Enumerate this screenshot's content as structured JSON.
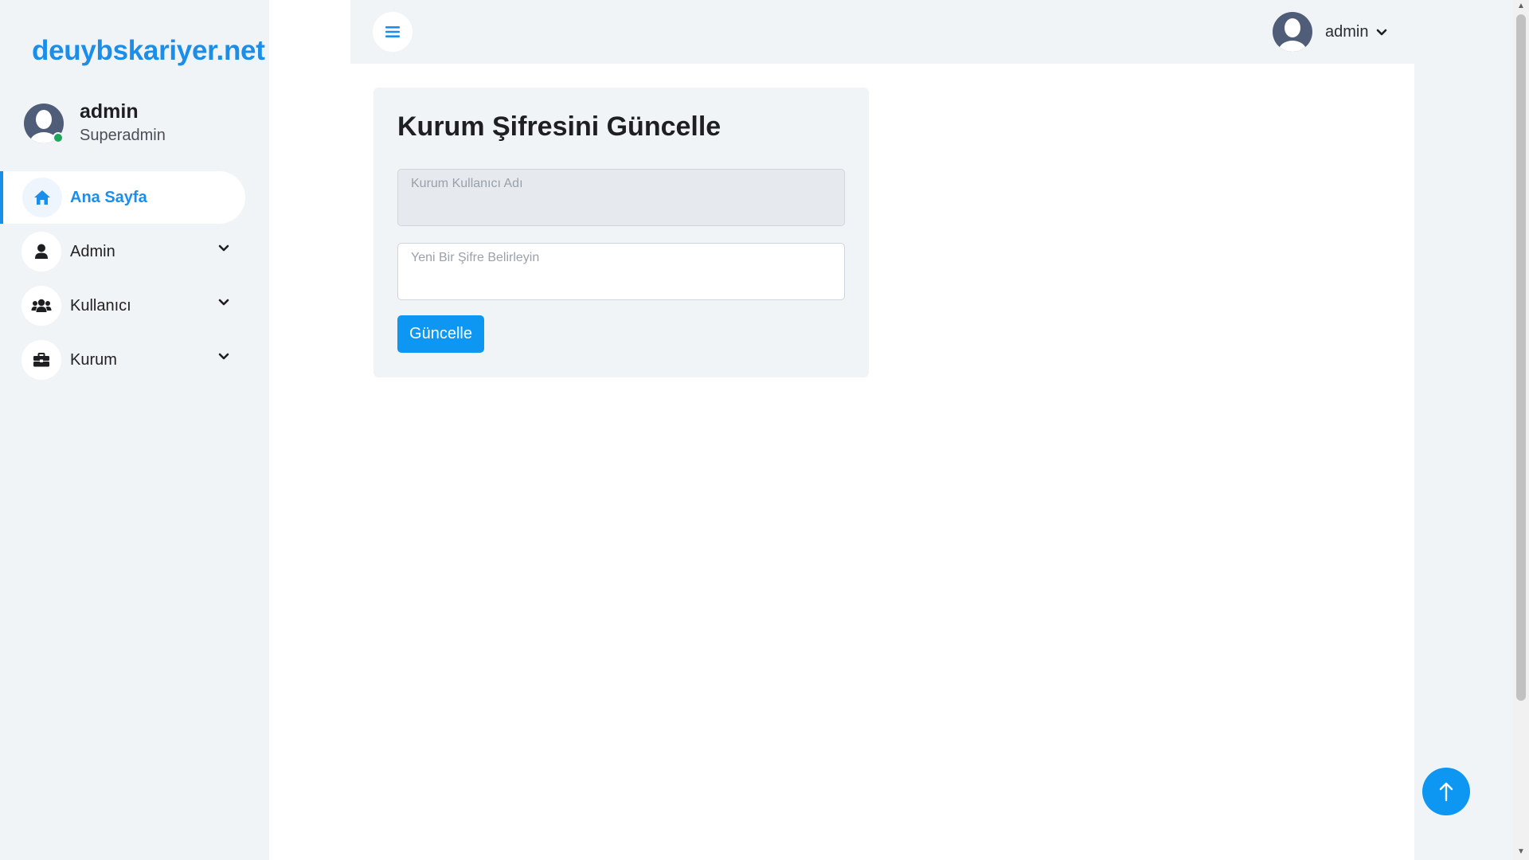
{
  "brand": "deuybskariyer.net",
  "profile": {
    "name": "admin",
    "role": "Superadmin"
  },
  "sidebar": {
    "items": [
      {
        "label": "Ana Sayfa",
        "icon": "home-icon",
        "active": true
      },
      {
        "label": "Admin",
        "icon": "user-icon",
        "active": false
      },
      {
        "label": "Kullanıcı",
        "icon": "users-icon",
        "active": false
      },
      {
        "label": "Kurum",
        "icon": "briefcase-icon",
        "active": false
      }
    ]
  },
  "topbar": {
    "user_name": "admin"
  },
  "form": {
    "title": "Kurum Şifresini Güncelle",
    "username_placeholder": "Kurum Kullanıcı Adı",
    "username_value": "",
    "password_placeholder": "Yeni Bir Şifre Belirleyin",
    "password_value": "",
    "submit_label": "Güncelle"
  },
  "colors": {
    "accent": "#1b8eea",
    "button": "#0d96f2",
    "panel": "#f1f4f7",
    "online": "#1fa65a"
  }
}
